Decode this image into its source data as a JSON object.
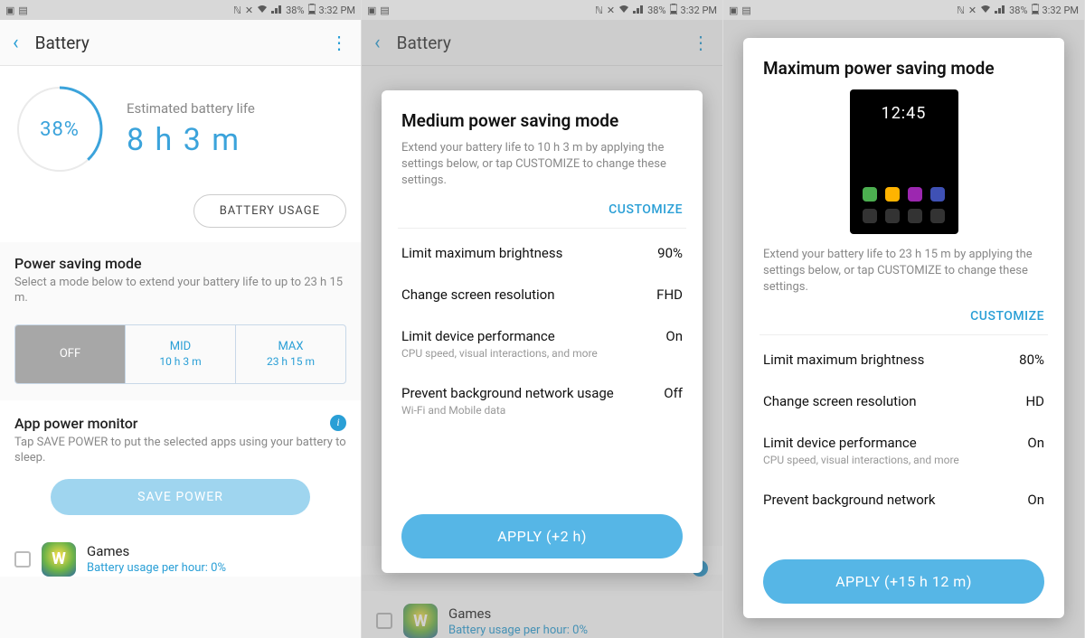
{
  "status": {
    "battery_pct": "38%",
    "time": "3:32 PM"
  },
  "appbar": {
    "title": "Battery"
  },
  "battery": {
    "percent": "38%",
    "estimate_label": "Estimated battery life",
    "estimate_value": "8 h 3 m",
    "usage_button": "BATTERY USAGE"
  },
  "power_saving": {
    "title": "Power saving mode",
    "desc": "Select a mode below to extend your battery life to up to 23 h 15 m.",
    "modes": {
      "off": {
        "label": "OFF",
        "time": ""
      },
      "mid": {
        "label": "MID",
        "time": "10 h 3 m"
      },
      "max": {
        "label": "MAX",
        "time": "23 h 15 m"
      }
    }
  },
  "apm": {
    "title": "App power monitor",
    "desc": "Tap SAVE POWER to put the selected apps using your battery to sleep.",
    "save_button": "SAVE POWER"
  },
  "app_row": {
    "name": "Games",
    "sub": "Battery usage per hour: 0%"
  },
  "dialog_mid": {
    "title": "Medium power saving mode",
    "desc": "Extend your battery life to 10 h 3 m by applying the settings below, or tap CUSTOMIZE to change these settings.",
    "customize": "CUSTOMIZE",
    "settings": {
      "brightness": {
        "title": "Limit maximum brightness",
        "value": "90%"
      },
      "resolution": {
        "title": "Change screen resolution",
        "value": "FHD"
      },
      "performance": {
        "title": "Limit device performance",
        "sub": "CPU speed, visual interactions, and more",
        "value": "On"
      },
      "network": {
        "title": "Prevent background network usage",
        "sub": "Wi-Fi and Mobile data",
        "value": "Off"
      }
    },
    "apply": "APPLY (+2 h)"
  },
  "dialog_max": {
    "title": "Maximum power saving mode",
    "preview_time": "12:45",
    "desc": "Extend your battery life to 23 h 15 m by applying the settings below, or tap CUSTOMIZE to change these settings.",
    "customize": "CUSTOMIZE",
    "settings": {
      "brightness": {
        "title": "Limit maximum brightness",
        "value": "80%"
      },
      "resolution": {
        "title": "Change screen resolution",
        "value": "HD"
      },
      "performance": {
        "title": "Limit device performance",
        "sub": "CPU speed, visual interactions, and more",
        "value": "On"
      },
      "network": {
        "title": "Prevent background network",
        "value": "On"
      }
    },
    "apply": "APPLY (+15 h 12 m)"
  }
}
